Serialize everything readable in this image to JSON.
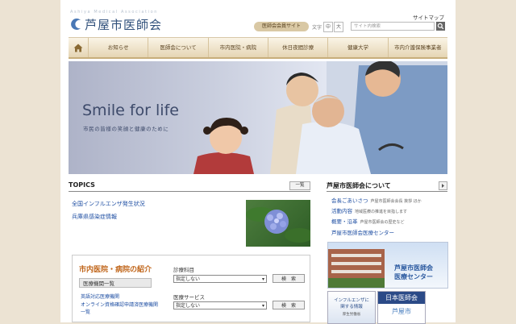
{
  "header": {
    "logo_en": "Ashiya Medical Association",
    "logo_jp": "芦屋市医師会",
    "sitemap": "サイトマップ",
    "members_site": "医師会会員サイト",
    "font_size_label": "文字",
    "font_sizes": [
      "中",
      "大"
    ],
    "search_placeholder": "サイト内検索"
  },
  "nav": {
    "home_icon": "home-icon",
    "items": [
      "お知らせ",
      "医師会について",
      "市内医院・病院",
      "休日夜間診療",
      "健康大学",
      "市内介護保険事業者"
    ]
  },
  "hero": {
    "title": "Smile for life",
    "subtitle": "市民の皆様の笑顔と健康のために"
  },
  "topics": {
    "title": "TOPICS",
    "more": "一覧",
    "items": [
      "全国インフルエンザ発生状況",
      "兵庫県感染症情報"
    ]
  },
  "clinic": {
    "title": "市内医院・病院の紹介",
    "list_button": "医療機関一覧",
    "links": [
      "英語対応医療機関",
      "オンライン資格確認申請済医療機関一覧"
    ],
    "dept_label": "診療科目",
    "dept_value": "指定しない",
    "service_label": "医療サービス",
    "service_value": "指定しない",
    "search_button": "検　索"
  },
  "about": {
    "title": "芦屋市医師会について",
    "links": [
      {
        "label": "会長ごあいさつ",
        "desc": "芦屋市医師会会長 挨拶 ほか"
      },
      {
        "label": "活動内容",
        "desc": "地域医療の推進を目指します"
      },
      {
        "label": "概要・沿革",
        "desc": "芦屋市医師会の歴史など"
      },
      {
        "label": "芦屋市医師会医療センター",
        "desc": ""
      }
    ],
    "center_banner": [
      "芦屋市医師会",
      "医療センター"
    ]
  },
  "banners": {
    "flu": [
      "インフルエンザに",
      "関する情報",
      "厚生労働省"
    ],
    "jma": [
      "日本医師会",
      "芦屋市"
    ]
  },
  "colors": {
    "nav_text": "#5a4322",
    "link": "#1f4fa3",
    "clinic_title": "#c0651a",
    "brand_blue": "#2f4f7a"
  }
}
